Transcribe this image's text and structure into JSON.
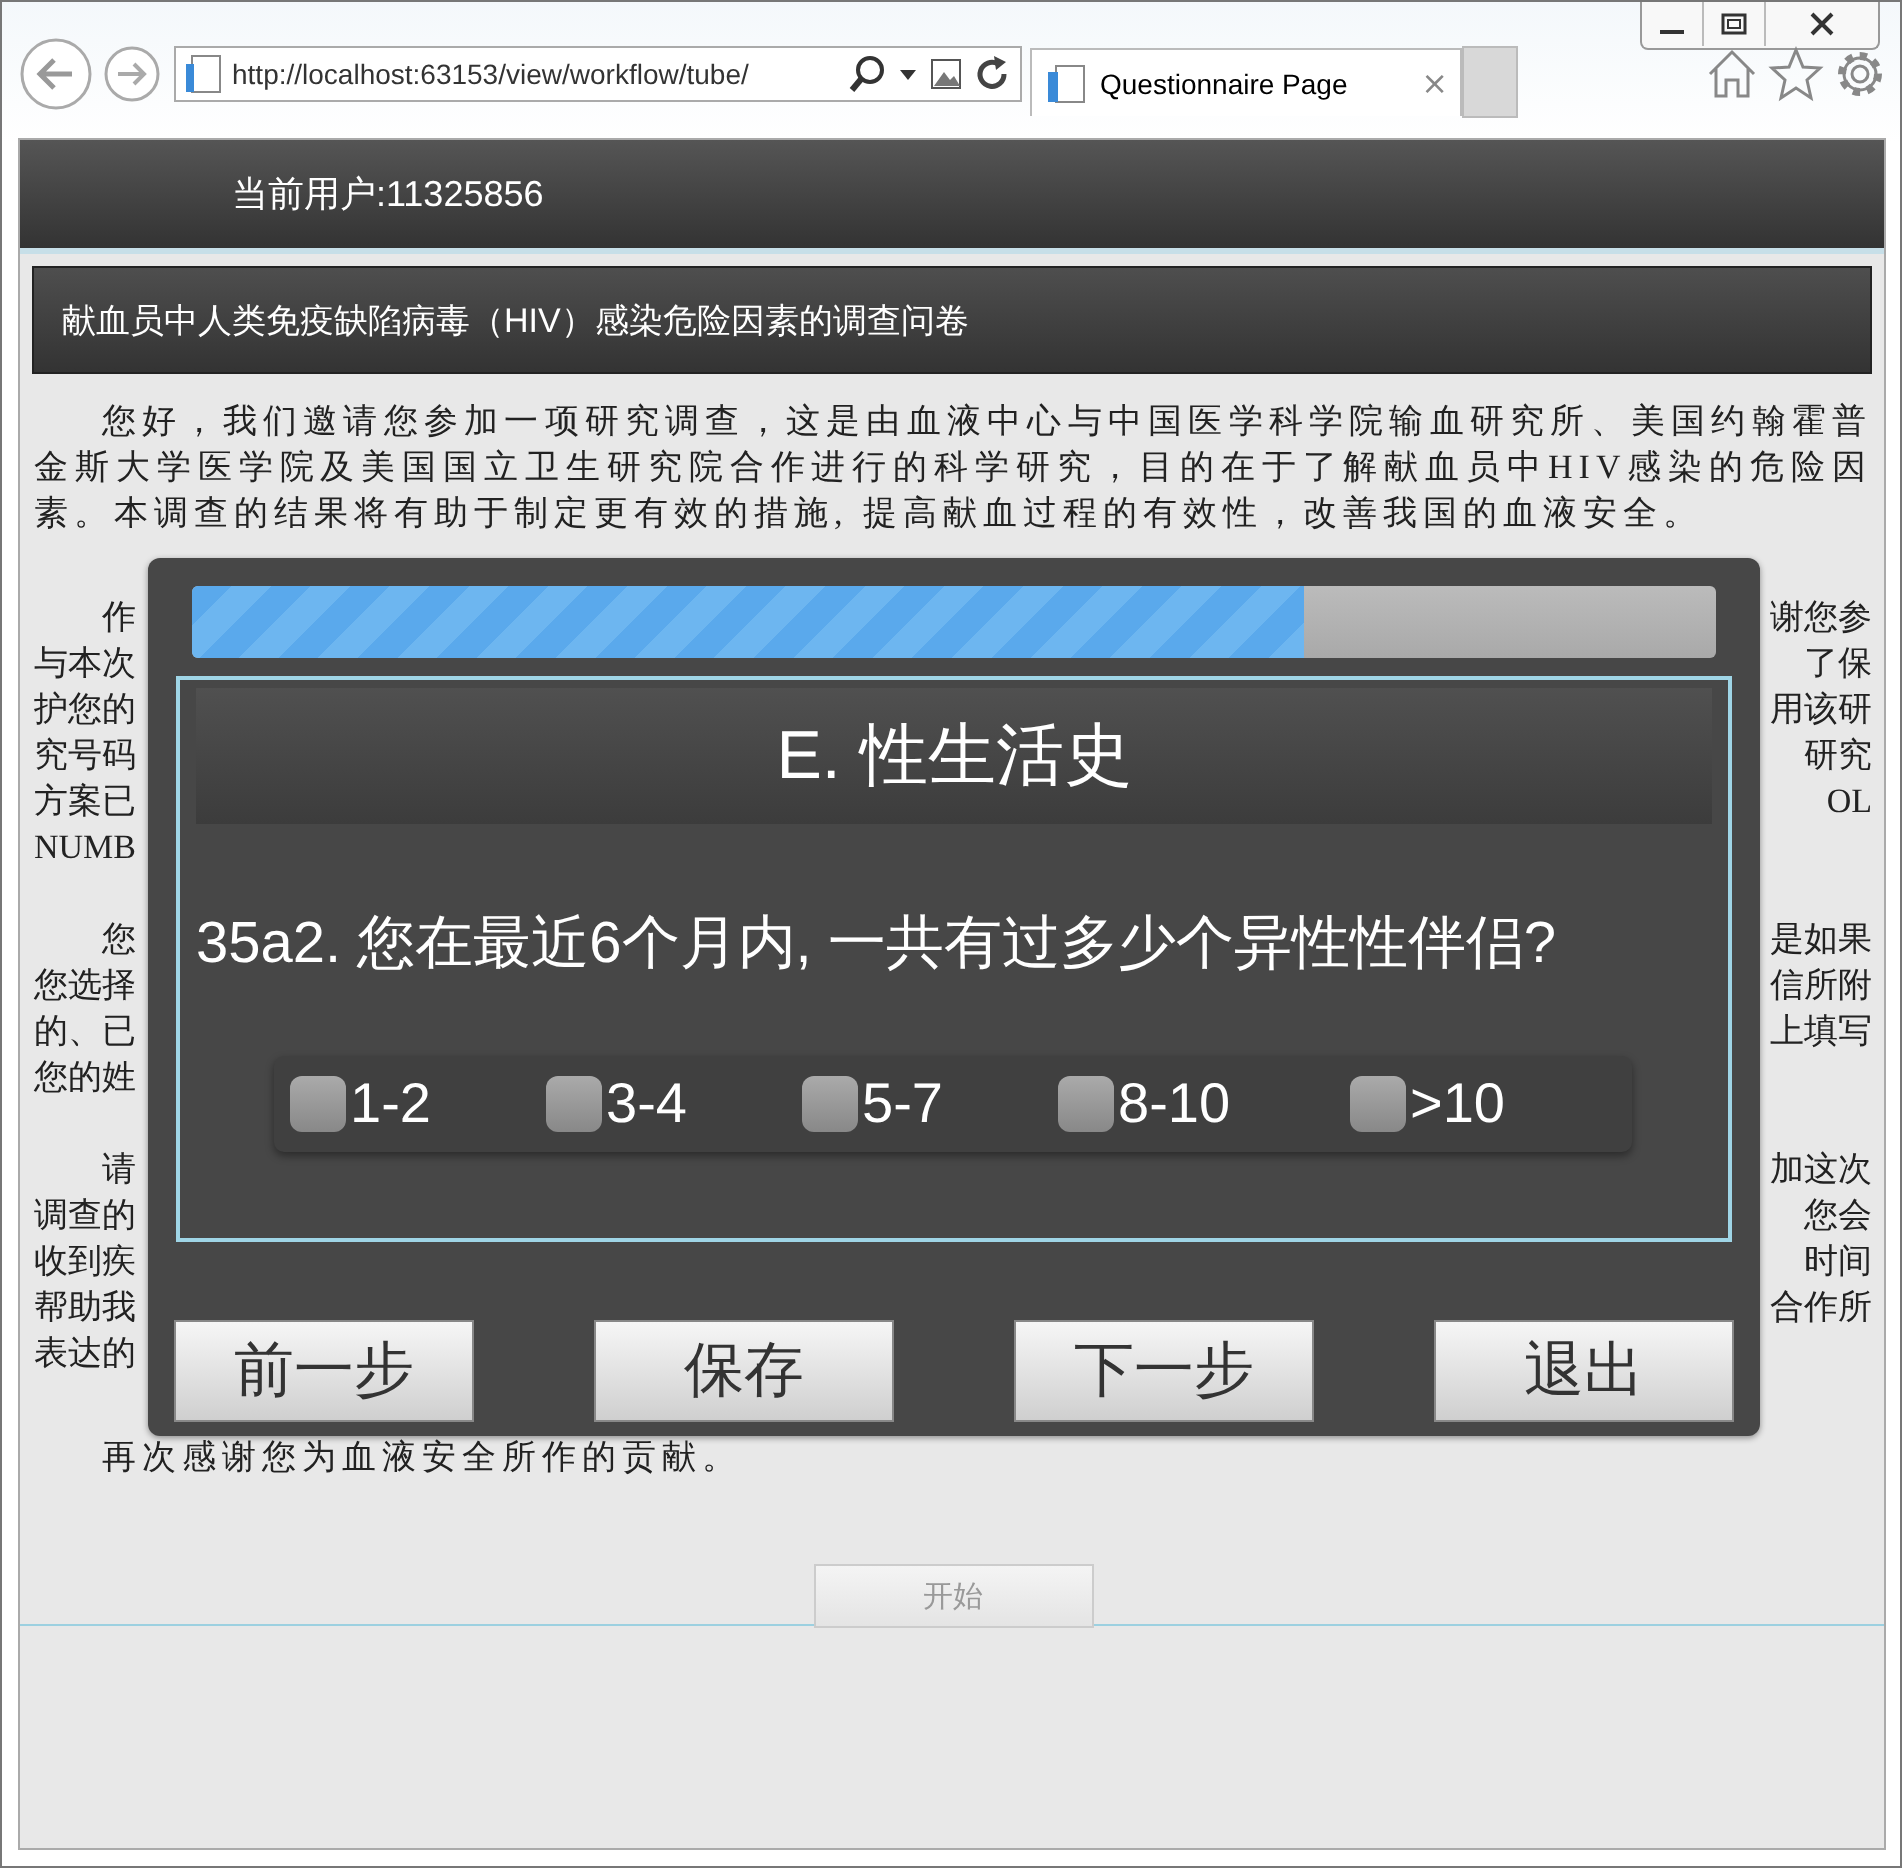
{
  "browser": {
    "address": "http://localhost:63153/view/workflow/tube/",
    "tab": {
      "title": "Questionnaire Page",
      "close": "×"
    }
  },
  "header": {
    "user_label": "当前用户:11325856"
  },
  "page_title": "献血员中人类免疫缺陷病毒（HIV）感染危险因素的调查问卷",
  "intro": "您好，我们邀请您参加一项研究调查，这是由血液中心与中国医学科学院输血研究所、美国约翰霍普金斯大学医学院及美国国立卫生研究院合作进行的科学研究，目的在于了解献血员中HIV感染的危险因素。本调查的结果将有助于制定更有效的措施, 提高献血过程的有效性，改善我国的血液安全。",
  "covered_paragraphs": [
    {
      "lines": [
        {
          "left": "作",
          "right": "谢您参"
        },
        {
          "left": "与本次",
          "right": "了保"
        },
        {
          "left": "护您的",
          "right": "用该研"
        },
        {
          "left": "究号码",
          "right": "研究"
        },
        {
          "left": "方案已",
          "right": "OL"
        },
        {
          "left": "NUMB"
        }
      ]
    },
    {
      "lines": [
        {
          "left": "您",
          "right": "是如果"
        },
        {
          "left": "您选择",
          "right": "信所附"
        },
        {
          "left": "的、已",
          "right": "上填写"
        },
        {
          "left": "您的姓"
        }
      ]
    },
    {
      "lines": [
        {
          "left": "请",
          "right": "加这次"
        },
        {
          "left": "调查的",
          "right": "您会"
        },
        {
          "left": "收到疾",
          "right": "时间"
        },
        {
          "left": "帮助我",
          "right": "合作所"
        },
        {
          "left": "表达的"
        }
      ]
    }
  ],
  "closing": "再次感谢您为血液安全所作的贡献。",
  "start_button": {
    "label": "开始",
    "disabled": true
  },
  "dialog": {
    "progress": {
      "level": 0.73
    },
    "section_title": "E. 性生活史",
    "question": "35a2. 您在最近6个月内, 一共有过多少个异性性伴侣?",
    "options": [
      {
        "label": "1-2",
        "checked": false
      },
      {
        "label": "3-4",
        "checked": false
      },
      {
        "label": "5-7",
        "checked": false
      },
      {
        "label": "8-10",
        "checked": false
      },
      {
        "label": ">10",
        "checked": false
      }
    ],
    "buttons": [
      "前一步",
      "保存",
      "下一步",
      "退出"
    ]
  }
}
